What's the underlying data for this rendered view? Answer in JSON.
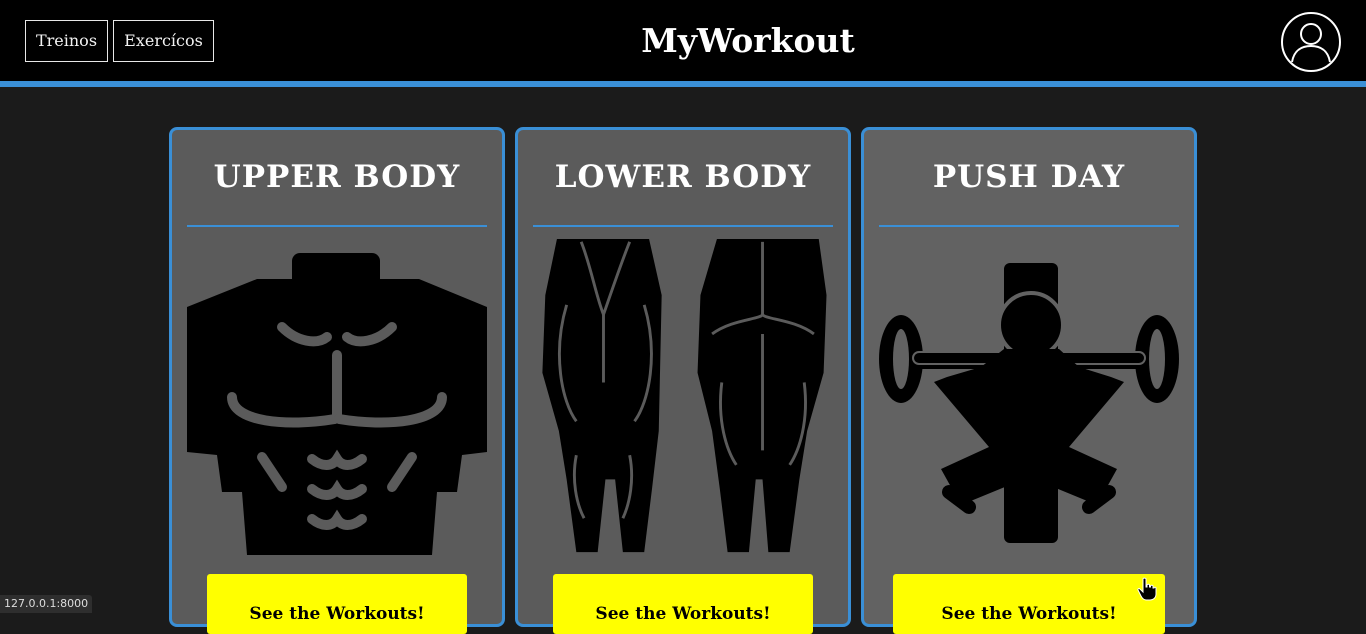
{
  "header": {
    "nav": [
      {
        "label": "Treinos"
      },
      {
        "label": "Exercícos"
      }
    ],
    "brand": "MyWorkout",
    "avatar_icon": "user-circle-icon"
  },
  "cards": [
    {
      "title": "UPPER BODY",
      "image_icon": "torso-muscles-icon",
      "button_label": "See the Workouts!"
    },
    {
      "title": "LOWER BODY",
      "image_icon": "legs-muscles-icon",
      "button_label": "See the Workouts!"
    },
    {
      "title": "PUSH DAY",
      "image_icon": "barbell-squat-icon",
      "button_label": "See the Workouts!"
    }
  ],
  "status_bar": {
    "url": "127.0.0.1:8000"
  },
  "colors": {
    "accent": "#3a8fd6",
    "cta": "#ffff00",
    "header_bg": "#000000",
    "page_bg": "#1b1b1b",
    "card_bg": "#5b5b5b"
  }
}
